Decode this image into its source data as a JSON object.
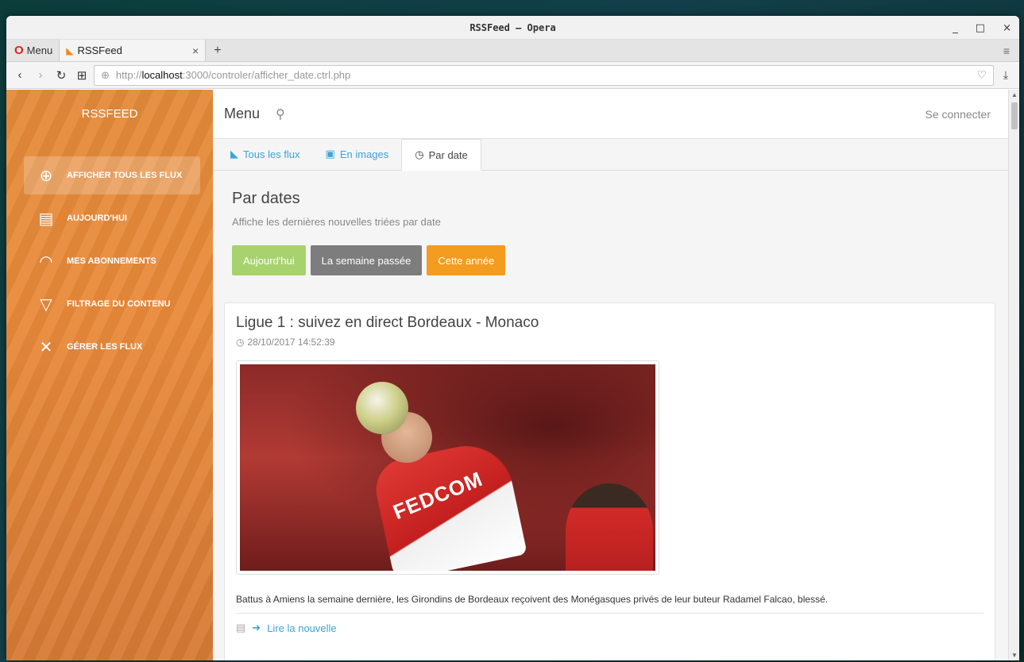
{
  "window": {
    "title": "RSSFeed – Opera",
    "controls": {
      "minimize": "_",
      "maximize": "□",
      "close": "×"
    }
  },
  "browser": {
    "menu_label": "Menu",
    "tab": {
      "title": "RSSFeed",
      "close": "×"
    },
    "new_tab": "+",
    "url": {
      "prefix": "http://",
      "host": "localhost",
      "rest": ":3000/controler/afficher_date.ctrl.php"
    }
  },
  "sidebar": {
    "brand": "RSSFEED",
    "items": [
      {
        "label": "AFFICHER TOUS LES FLUX",
        "icon": "globe-icon",
        "active": true
      },
      {
        "label": "AUJOURD'HUI",
        "icon": "newspaper-icon",
        "active": false
      },
      {
        "label": "MES ABONNEMENTS",
        "icon": "wifi-icon",
        "active": false
      },
      {
        "label": "FILTRAGE DU CONTENU",
        "icon": "filter-icon",
        "active": false
      },
      {
        "label": "GÉRER LES FLUX",
        "icon": "tools-icon",
        "active": false
      }
    ]
  },
  "topnav": {
    "menu_label": "Menu",
    "login": "Se connecter"
  },
  "tabs": [
    {
      "label": "Tous les flux",
      "icon": "rss-icon",
      "active": false
    },
    {
      "label": "En images",
      "icon": "image-icon",
      "active": false
    },
    {
      "label": "Par date",
      "icon": "clock-icon",
      "active": true
    }
  ],
  "section": {
    "title": "Par dates",
    "subtitle": "Affiche les dernières nouvelles triées par date",
    "buttons": {
      "today": "Aujourd'hui",
      "last_week": "La semaine passée",
      "this_year": "Cette année"
    }
  },
  "article": {
    "title": "Ligue 1 : suivez en direct Bordeaux - Monaco",
    "date": "28/10/2017 14:52:39",
    "image_text": "FEDCOM",
    "description": "Battus à Amiens la semaine dernière, les Girondins de Bordeaux reçoivent des Monégasques privés de leur buteur Radamel Falcao, blessé.",
    "read_more": "Lire la nouvelle"
  },
  "colors": {
    "accent_blue": "#3aa5d8",
    "sidebar_orange": "#e48a3a",
    "btn_green": "#a8d26d",
    "btn_gray": "#7d7d7d",
    "btn_orange": "#f39c1f"
  }
}
